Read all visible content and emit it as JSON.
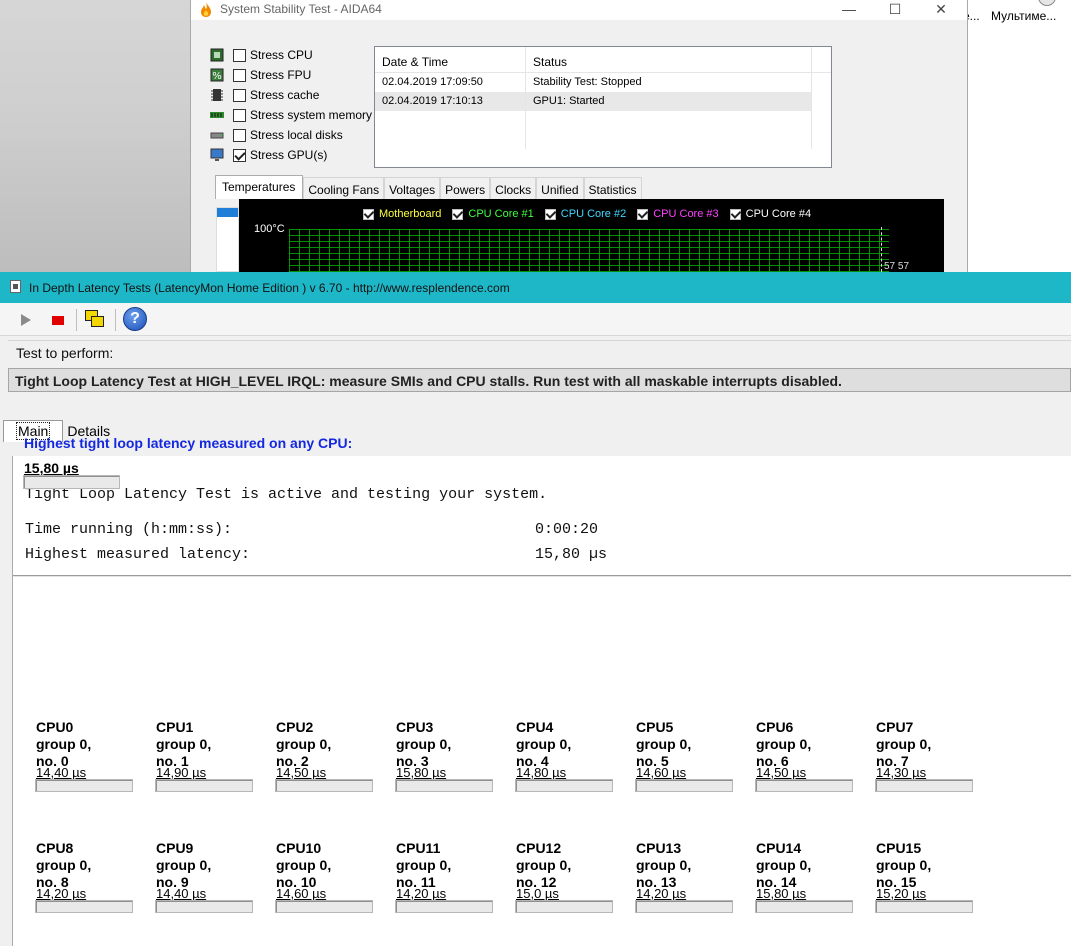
{
  "desktop": {
    "icon_a_label": "е...",
    "icon_b_label": "Мультиме..."
  },
  "aida": {
    "title": "System Stability Test - AIDA64",
    "window_controls": {
      "minimize": "—",
      "maximize": "☐",
      "close": "✕"
    },
    "stress_options": [
      {
        "label": "Stress CPU",
        "checked": false,
        "icon": "cpu-chip-icon"
      },
      {
        "label": "Stress FPU",
        "checked": false,
        "icon": "fpu-percent-icon"
      },
      {
        "label": "Stress cache",
        "checked": false,
        "icon": "cache-chip-icon"
      },
      {
        "label": "Stress system memory",
        "checked": false,
        "icon": "memory-module-icon"
      },
      {
        "label": "Stress local disks",
        "checked": false,
        "icon": "disk-drive-icon"
      },
      {
        "label": "Stress GPU(s)",
        "checked": true,
        "icon": "monitor-icon"
      }
    ],
    "log": {
      "headers": [
        "Date & Time",
        "Status"
      ],
      "rows": [
        [
          "02.04.2019 17:09:50",
          "Stability Test: Stopped"
        ],
        [
          "02.04.2019 17:10:13",
          "GPU1: Started"
        ]
      ]
    },
    "tabs": [
      "Temperatures",
      "Cooling Fans",
      "Voltages",
      "Powers",
      "Clocks",
      "Unified",
      "Statistics"
    ],
    "active_tab": "Temperatures",
    "graph": {
      "y_max_label": "100°C",
      "current_value": "57 57",
      "legend": [
        {
          "label": "Motherboard",
          "color": "#ffff40",
          "checked": true
        },
        {
          "label": "CPU Core #1",
          "color": "#40ff40",
          "checked": true
        },
        {
          "label": "CPU Core #2",
          "color": "#40d8ff",
          "checked": true
        },
        {
          "label": "CPU Core #3",
          "color": "#ff40ff",
          "checked": true
        },
        {
          "label": "CPU Core #4",
          "color": "#ffffff",
          "checked": true
        }
      ]
    }
  },
  "latencymon": {
    "title": "In Depth Latency Tests  (LatencyMon Home Edition )  v 6.70 - http://www.resplendence.com",
    "title_color": "#1eb7c7",
    "toolbar": [
      "play-icon",
      "stop-icon",
      "windows-icon",
      "help-icon"
    ],
    "help_glyph": "?",
    "test_label": "Test to perform:",
    "test_description": "Tight Loop Latency Test at HIGH_LEVEL IRQL:  measure SMIs and CPU stalls. Run test with all maskable interrupts disabled.",
    "tabs": [
      "Main",
      "Details"
    ],
    "active_tab": "Main",
    "status_line": "Tight Loop Latency Test is active and testing your system.",
    "time_running_label": "Time running (h:mm:ss):",
    "time_running_value": "0:00:20",
    "highest_latency_label": "Highest measured latency:",
    "highest_latency_value": "15,80 µs",
    "any_cpu_title": "Highest tight loop latency measured on any CPU:",
    "any_cpu_value": "15,80 µs",
    "any_cpu_title_color": "#1428e0",
    "cpus": [
      {
        "name": "CPU0",
        "group": "group 0,",
        "no": "no. 0",
        "value": "14,40 µs"
      },
      {
        "name": "CPU1",
        "group": "group 0,",
        "no": "no. 1",
        "value": "14,90 µs"
      },
      {
        "name": "CPU2",
        "group": "group 0,",
        "no": "no. 2",
        "value": "14,50 µs"
      },
      {
        "name": "CPU3",
        "group": "group 0,",
        "no": "no. 3",
        "value": "15,80 µs"
      },
      {
        "name": "CPU4",
        "group": "group 0,",
        "no": "no. 4",
        "value": "14,80 µs"
      },
      {
        "name": "CPU5",
        "group": "group 0,",
        "no": "no. 5",
        "value": "14,60 µs"
      },
      {
        "name": "CPU6",
        "group": "group 0,",
        "no": "no. 6",
        "value": "14,50 µs"
      },
      {
        "name": "CPU7",
        "group": "group 0,",
        "no": "no. 7",
        "value": "14,30 µs"
      },
      {
        "name": "CPU8",
        "group": "group 0,",
        "no": "no. 8",
        "value": "14,20 µs"
      },
      {
        "name": "CPU9",
        "group": "group 0,",
        "no": "no. 9",
        "value": "14,40 µs"
      },
      {
        "name": "CPU10",
        "group": "group 0,",
        "no": "no. 10",
        "value": "14,60 µs"
      },
      {
        "name": "CPU11",
        "group": "group 0,",
        "no": "no. 11",
        "value": "14,20 µs"
      },
      {
        "name": "CPU12",
        "group": "group 0,",
        "no": "no. 12",
        "value": "15,0 µs"
      },
      {
        "name": "CPU13",
        "group": "group 0,",
        "no": "no. 13",
        "value": "14,20 µs"
      },
      {
        "name": "CPU14",
        "group": "group 0,",
        "no": "no. 14",
        "value": "15,80 µs"
      },
      {
        "name": "CPU15",
        "group": "group 0,",
        "no": "no. 15",
        "value": "15,20 µs"
      }
    ]
  }
}
